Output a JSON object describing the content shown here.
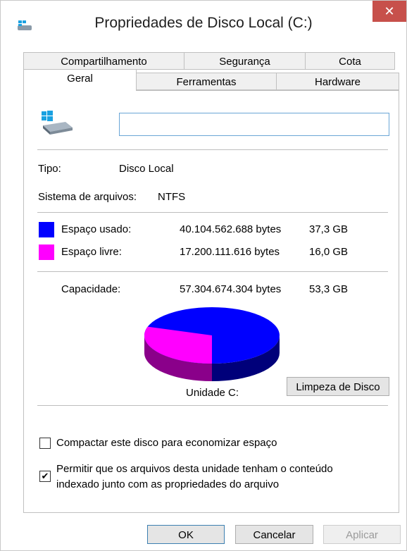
{
  "window": {
    "title": "Propriedades de Disco Local (C:)",
    "close_symbol": "✕"
  },
  "tabs": {
    "row1": [
      "Compartilhamento",
      "Segurança",
      "Cota"
    ],
    "row2": [
      "Geral",
      "Ferramentas",
      "Hardware"
    ],
    "active": "Geral"
  },
  "general": {
    "name_value": "",
    "type_label": "Tipo:",
    "type_value": "Disco Local",
    "fs_label": "Sistema de arquivos:",
    "fs_value": "NTFS",
    "used": {
      "label": "Espaço usado:",
      "bytes": "40.104.562.688 bytes",
      "size": "37,3 GB",
      "color": "#0000ff"
    },
    "free": {
      "label": "Espaço livre:",
      "bytes": "17.200.111.616 bytes",
      "size": "16,0 GB",
      "color": "#ff00ff"
    },
    "capacity": {
      "label": "Capacidade:",
      "bytes": "57.304.674.304 bytes",
      "size": "53,3 GB"
    },
    "pie": {
      "used_fraction": 0.7,
      "free_fraction": 0.3
    },
    "drive_label": "Unidade C:",
    "cleanup_button": "Limpeza de Disco",
    "compress_label": "Compactar este disco para economizar espaço",
    "compress_checked": false,
    "index_label_line1": "Permitir que os arquivos desta unidade tenham o conteúdo",
    "index_label_line2": "indexado junto com as propriedades do arquivo",
    "index_checked": true
  },
  "buttons": {
    "ok": "OK",
    "cancel": "Cancelar",
    "apply": "Aplicar"
  },
  "icons": {
    "title_icon": "drive-icon",
    "drive_icon": "windows-drive-icon",
    "check_mark": "✔"
  }
}
